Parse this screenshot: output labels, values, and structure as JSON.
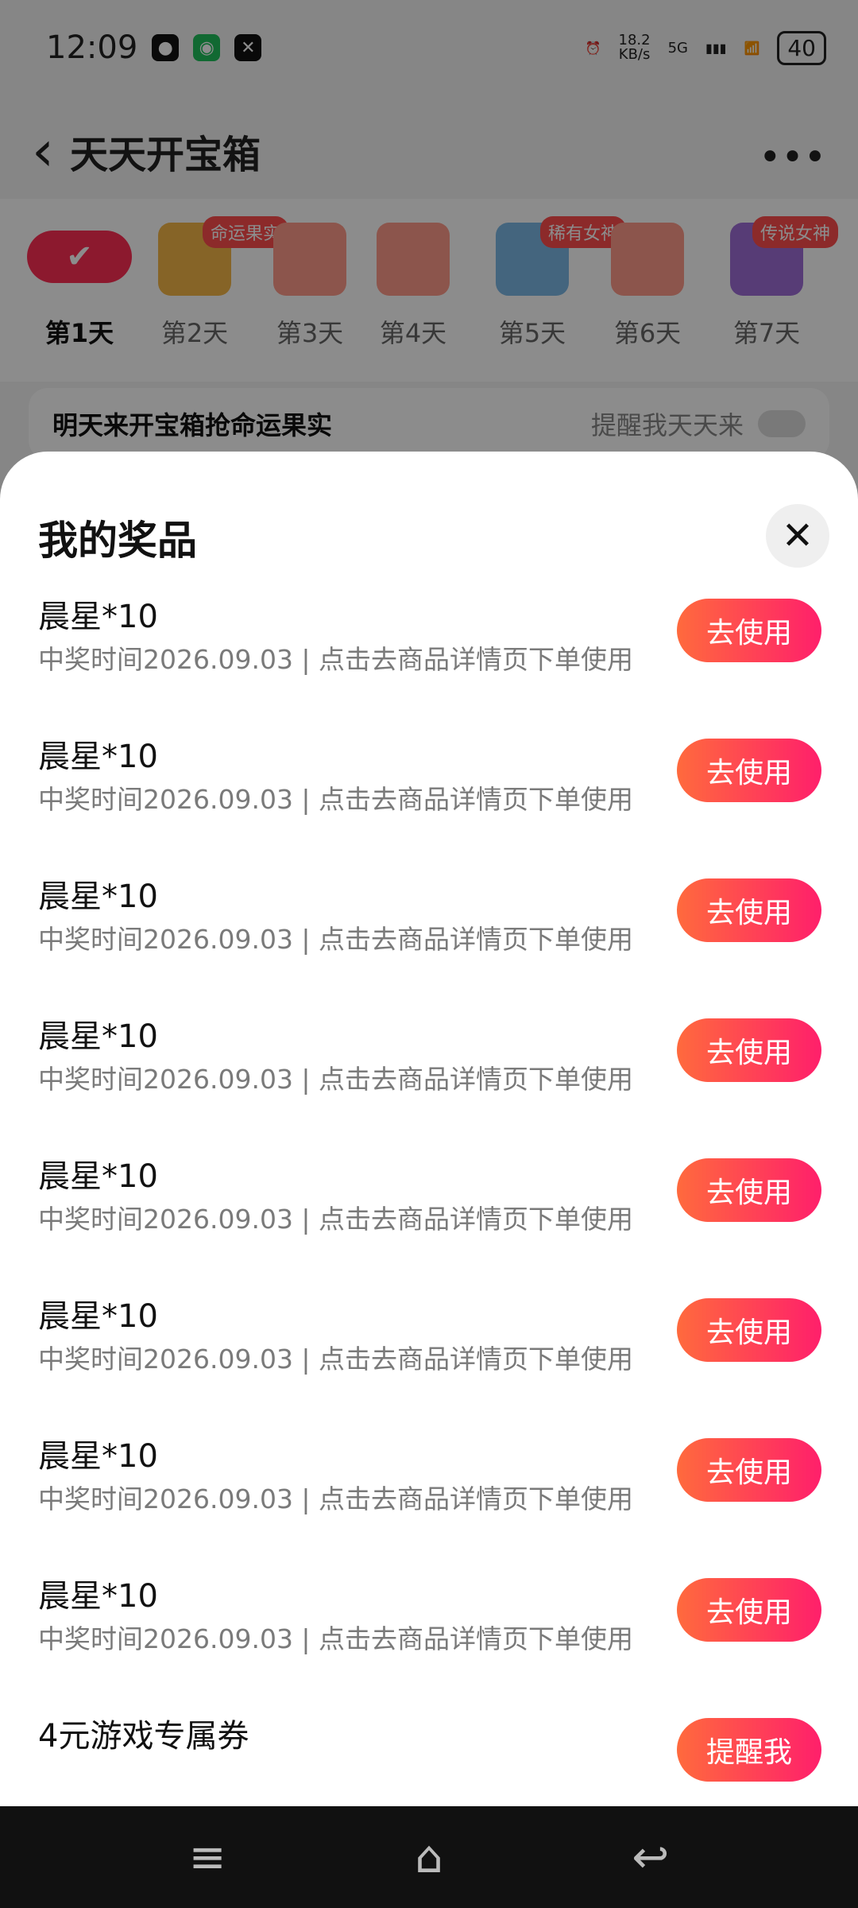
{
  "status_bar": {
    "time": "12:09",
    "speed_value": "18.2",
    "speed_unit": "KB/s",
    "network": "5G",
    "battery": "40"
  },
  "header": {
    "back_icon": "back-arrow",
    "title": "天天开宝箱",
    "more_icon": "more-dots"
  },
  "days": [
    {
      "label": "第1天",
      "tag": "",
      "active": true
    },
    {
      "label": "第2天",
      "tag": "命运果实",
      "active": false
    },
    {
      "label": "第3天",
      "tag": "",
      "active": false
    },
    {
      "label": "第4天",
      "tag": "",
      "active": false
    },
    {
      "label": "第5天",
      "tag": "稀有女神",
      "active": false
    },
    {
      "label": "第6天",
      "tag": "",
      "active": false
    },
    {
      "label": "第7天",
      "tag": "传说女神",
      "active": false
    }
  ],
  "reminder": {
    "text": "明天来开宝箱抢命运果实",
    "toggle_label": "提醒我天天来"
  },
  "sheet": {
    "title": "我的奖品",
    "close_icon": "close-icon",
    "items": [
      {
        "title": "晨星*10",
        "subtitle": "中奖时间2026.09.03 | 点击去商品详情页下单使用",
        "button": "去使用"
      },
      {
        "title": "晨星*10",
        "subtitle": "中奖时间2026.09.03 | 点击去商品详情页下单使用",
        "button": "去使用"
      },
      {
        "title": "晨星*10",
        "subtitle": "中奖时间2026.09.03 | 点击去商品详情页下单使用",
        "button": "去使用"
      },
      {
        "title": "晨星*10",
        "subtitle": "中奖时间2026.09.03 | 点击去商品详情页下单使用",
        "button": "去使用"
      },
      {
        "title": "晨星*10",
        "subtitle": "中奖时间2026.09.03 | 点击去商品详情页下单使用",
        "button": "去使用"
      },
      {
        "title": "晨星*10",
        "subtitle": "中奖时间2026.09.03 | 点击去商品详情页下单使用",
        "button": "去使用"
      },
      {
        "title": "晨星*10",
        "subtitle": "中奖时间2026.09.03 | 点击去商品详情页下单使用",
        "button": "去使用"
      },
      {
        "title": "晨星*10",
        "subtitle": "中奖时间2026.09.03 | 点击去商品详情页下单使用",
        "button": "去使用"
      },
      {
        "title": "4元游戏专属券",
        "subtitle": "",
        "button": "提醒我"
      }
    ]
  },
  "nav": {
    "menu_icon": "menu-icon",
    "home_icon": "home-icon",
    "back_icon": "back-icon"
  }
}
